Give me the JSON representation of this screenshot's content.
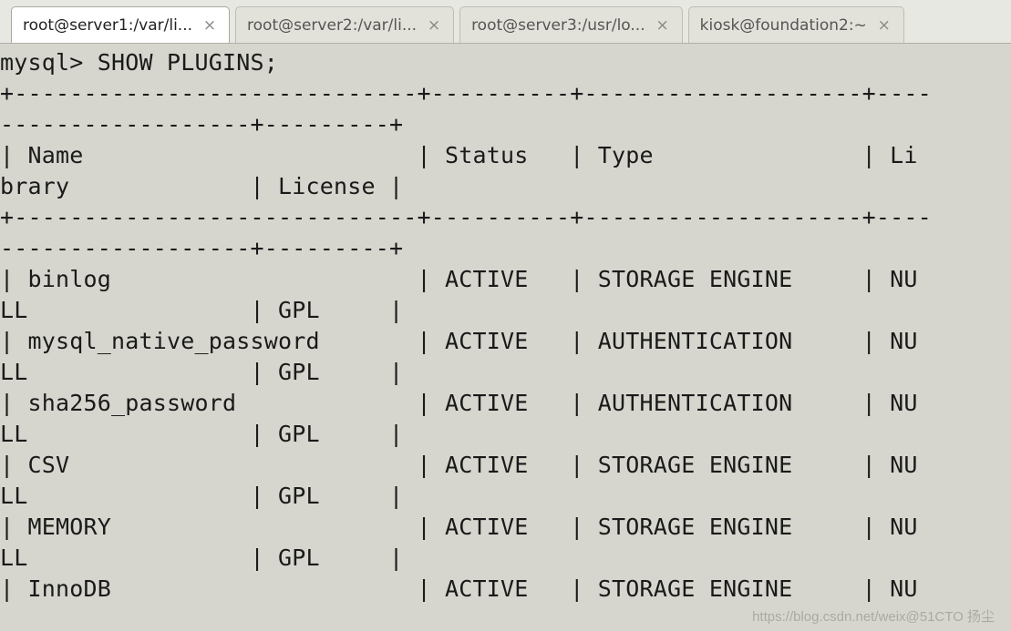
{
  "tabs": [
    {
      "label": "root@server1:/var/li...",
      "active": true
    },
    {
      "label": "root@server2:/var/li...",
      "active": false
    },
    {
      "label": "root@server3:/usr/lo...",
      "active": false
    },
    {
      "label": "kiosk@foundation2:~",
      "active": false
    }
  ],
  "terminal": {
    "prompt": "mysql> ",
    "command": "SHOW PLUGINS;",
    "headers": [
      "Name",
      "Status",
      "Type",
      "Li",
      "brary",
      "License"
    ],
    "rows": [
      {
        "name": "binlog",
        "status": "ACTIVE",
        "type": "STORAGE ENGINE",
        "lib": "NU",
        "lib2": "LL",
        "license": "GPL"
      },
      {
        "name": "mysql_native_password",
        "status": "ACTIVE",
        "type": "AUTHENTICATION",
        "lib": "NU",
        "lib2": "LL",
        "license": "GPL"
      },
      {
        "name": "sha256_password",
        "status": "ACTIVE",
        "type": "AUTHENTICATION",
        "lib": "NU",
        "lib2": "LL",
        "license": "GPL"
      },
      {
        "name": "CSV",
        "status": "ACTIVE",
        "type": "STORAGE ENGINE",
        "lib": "NU",
        "lib2": "LL",
        "license": "GPL"
      },
      {
        "name": "MEMORY",
        "status": "ACTIVE",
        "type": "STORAGE ENGINE",
        "lib": "NU",
        "lib2": "LL",
        "license": "GPL"
      },
      {
        "name": "InnoDB",
        "status": "ACTIVE",
        "type": "STORAGE ENGINE",
        "lib": "NU",
        "lib2": "",
        "license": ""
      }
    ],
    "sep_top": "+-----------------------------+----------+--------------------+----",
    "sep_top2": "------------------+---------+",
    "sep_mid": "+-----------------------------+----------+--------------------+----",
    "sep_mid2": "------------------+---------+"
  },
  "watermark": "https://blog.csdn.net/weix@51CTO 扬尘"
}
